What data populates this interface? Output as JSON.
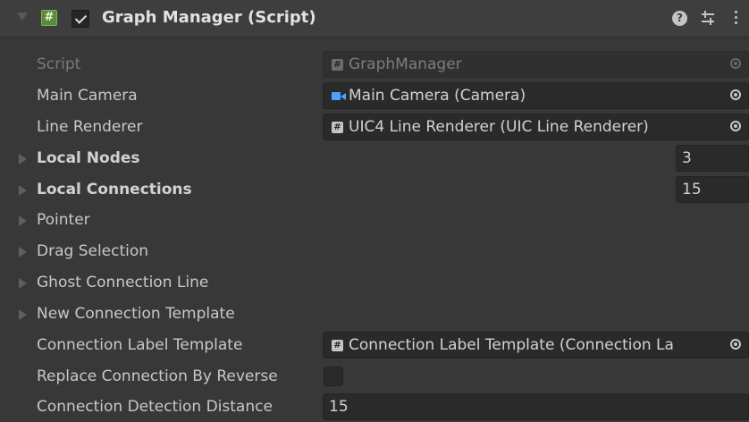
{
  "component": {
    "title": "Graph Manager (Script)",
    "enabled": true,
    "help_icon": "help-icon",
    "preset_icon": "preset-icon",
    "menu_icon": "kebab-menu-icon"
  },
  "fields": {
    "script": {
      "label": "Script",
      "value": "GraphManager",
      "icon": "script-icon"
    },
    "main_camera": {
      "label": "Main Camera",
      "value": "Main Camera (Camera)",
      "icon": "camera-icon"
    },
    "line_renderer": {
      "label": "Line Renderer",
      "value": "UIC4 Line Renderer (UIC Line Renderer)",
      "icon": "script-icon"
    },
    "local_nodes": {
      "label": "Local Nodes",
      "value": "3"
    },
    "local_connections": {
      "label": "Local Connections",
      "value": "15"
    },
    "pointer": {
      "label": "Pointer"
    },
    "drag_selection": {
      "label": "Drag Selection"
    },
    "ghost_connection_line": {
      "label": "Ghost Connection Line"
    },
    "new_connection_template": {
      "label": "New Connection Template"
    },
    "connection_label_template": {
      "label": "Connection Label Template",
      "value": "Connection Label Template (Connection La",
      "icon": "script-icon"
    },
    "replace_connection_by_reverse": {
      "label": "Replace Connection By Reverse",
      "checked": false
    },
    "connection_detection_distance": {
      "label": "Connection Detection Distance",
      "value": "15"
    }
  },
  "colors": {
    "background": "#383838",
    "header": "#3e3e3e",
    "field": "#2a2a2a",
    "camera_accent": "#4aa3ff",
    "script_badge": "#5a8a3a"
  }
}
